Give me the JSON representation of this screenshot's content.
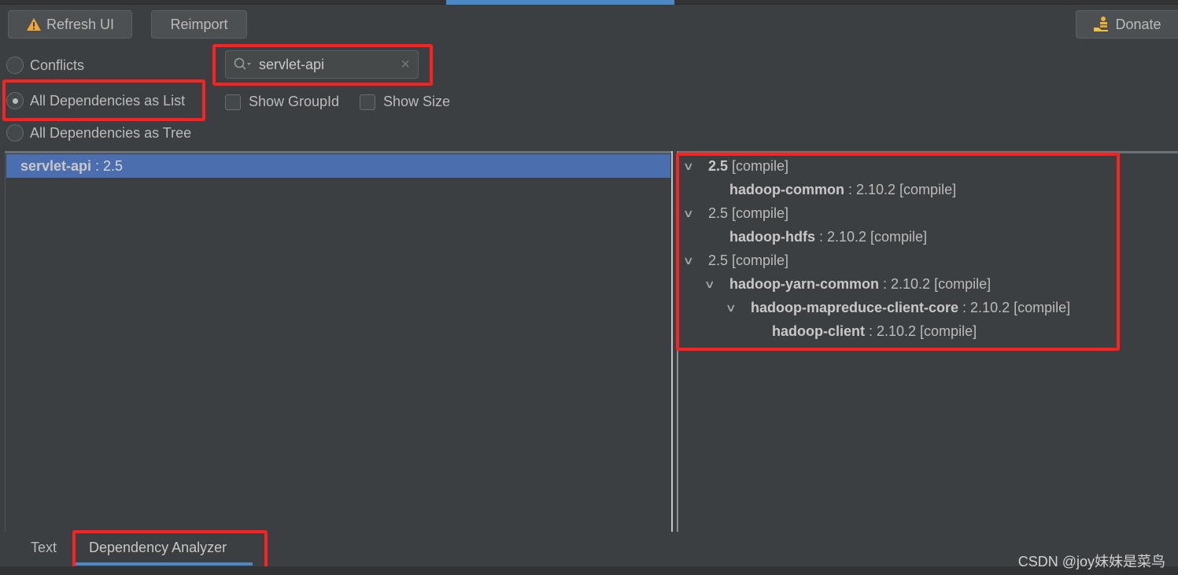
{
  "toolbar": {
    "refresh_label": "Refresh UI",
    "reimport_label": "Reimport",
    "donate_label": "Donate"
  },
  "modes": {
    "conflicts": "Conflicts",
    "list": "All Dependencies as List",
    "tree": "All Dependencies as Tree",
    "selected": "list"
  },
  "search": {
    "value": "servlet-api"
  },
  "options": {
    "show_group_id": "Show GroupId",
    "show_size": "Show Size",
    "show_group_id_checked": false,
    "show_size_checked": false
  },
  "list": {
    "items": [
      {
        "name": "servlet-api",
        "version": " : 2.5",
        "selected": true
      }
    ]
  },
  "tree": {
    "nodes": [
      {
        "level": 0,
        "name": "2.5",
        "rest": " [compile]",
        "bold": true,
        "expanded": true
      },
      {
        "level": 1,
        "name": "hadoop-common",
        "rest": " : 2.10.2 [compile]",
        "bold": true,
        "expanded": null
      },
      {
        "level": 0,
        "name": "2.5",
        "rest": " [compile]",
        "bold": false,
        "expanded": true
      },
      {
        "level": 1,
        "name": "hadoop-hdfs",
        "rest": " : 2.10.2 [compile]",
        "bold": true,
        "expanded": null
      },
      {
        "level": 0,
        "name": "2.5",
        "rest": " [compile]",
        "bold": false,
        "expanded": true
      },
      {
        "level": 1,
        "name": "hadoop-yarn-common",
        "rest": " : 2.10.2 [compile]",
        "bold": true,
        "expanded": true
      },
      {
        "level": 2,
        "name": "hadoop-mapreduce-client-core",
        "rest": " : 2.10.2 [compile]",
        "bold": true,
        "expanded": true
      },
      {
        "level": 3,
        "name": "hadoop-client",
        "rest": " : 2.10.2 [compile]",
        "bold": true,
        "expanded": null
      }
    ]
  },
  "tabs": [
    {
      "label": "Text",
      "active": false
    },
    {
      "label": "Dependency Analyzer",
      "active": true
    }
  ],
  "watermark": "CSDN @joy妹妹是菜鸟",
  "colors": {
    "highlight": "#ff2020",
    "selection": "#4b6eaf",
    "accent": "#4a88c7",
    "warning": "#f0a732"
  }
}
